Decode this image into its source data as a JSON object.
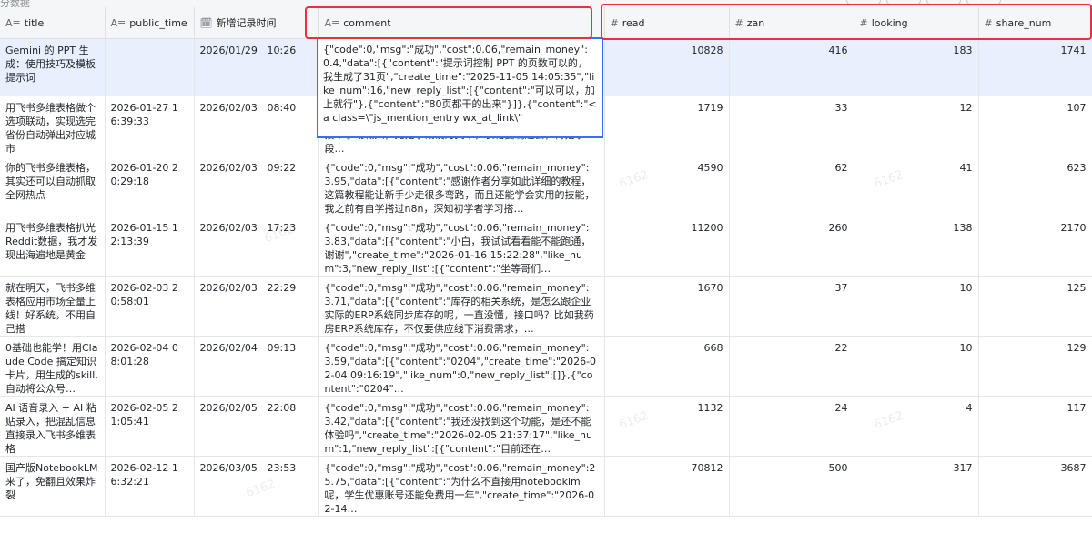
{
  "window": {
    "partial_label": "分数据"
  },
  "columns": [
    {
      "label": "title",
      "icon": "text-field-icon"
    },
    {
      "label": "public_time",
      "icon": "text-field-icon"
    },
    {
      "label": "新增记录时间",
      "icon": "created-time-icon"
    },
    {
      "label": "comment",
      "icon": "text-field-icon"
    },
    {
      "label": "read",
      "icon": "number-field-icon"
    },
    {
      "label": "zan",
      "icon": "number-field-icon"
    },
    {
      "label": "looking",
      "icon": "number-field-icon"
    },
    {
      "label": "share_num",
      "icon": "number-field-icon"
    }
  ],
  "rows": [
    {
      "title": "Gemini 的 PPT 生成：使用技巧及模板提示词",
      "public_time": "",
      "new_date": "2026/01/29",
      "new_time": "10:26",
      "comment": "",
      "read": "10828",
      "zan": "416",
      "looking": "183",
      "share_num": "1741"
    },
    {
      "title": "用飞书多维表格做个选项联动，实现选完省份自动弹出对应城市",
      "public_time": "2026-01-27 16:39:33",
      "new_date": "2026/02/03",
      "new_time": "08:40",
      "comment": "接个手动输入，先把字段设为文本，表格复制进去，再把字段…",
      "read": "1719",
      "zan": "33",
      "looking": "12",
      "share_num": "107"
    },
    {
      "title": "你的飞书多维表格，其实还可以自动抓取全网热点",
      "public_time": "2026-01-20 20:29:18",
      "new_date": "2026/02/03",
      "new_time": "09:22",
      "comment": "{\"code\":0,\"msg\":\"成功\",\"cost\":0.06,\"remain_money\":3.95,\"data\":[{\"content\":\"感谢作者分享如此详细的教程，这篇教程能让新手少走很多弯路，而且还能学会实用的技能，我之前有自学搭过n8n，深知初学者学习搭…",
      "read": "4590",
      "zan": "62",
      "looking": "41",
      "share_num": "623"
    },
    {
      "title": "用飞书多维表格扒光Reddit数据，我才发现出海遍地是黄金",
      "public_time": "2026-01-15 12:13:39",
      "new_date": "2026/02/03",
      "new_time": "17:23",
      "comment": "{\"code\":0,\"msg\":\"成功\",\"cost\":0.06,\"remain_money\":3.83,\"data\":[{\"content\":\"小白，我试试看看能不能跑通，谢谢\",\"create_time\":\"2026-01-16 15:22:28\",\"like_num\":3,\"new_reply_list\":[{\"content\":\"坐等哥们…",
      "read": "11200",
      "zan": "260",
      "looking": "138",
      "share_num": "2170"
    },
    {
      "title": "就在明天，飞书多维表格应用市场全量上线！好系统，不用自己搭",
      "public_time": "2026-02-03 20:58:01",
      "new_date": "2026/02/03",
      "new_time": "22:29",
      "comment": "{\"code\":0,\"msg\":\"成功\",\"cost\":0.06,\"remain_money\":3.71,\"data\":[{\"content\":\"库存的相关系统，是怎么跟企业实际的ERP系统同步库存的呢，一直没懂，接口吗？比如我药房ERP系统库存，不仅要供应线下消费需求，…",
      "read": "1670",
      "zan": "37",
      "looking": "10",
      "share_num": "125"
    },
    {
      "title": "0基础也能学！用Claude Code 搞定知识卡片，用生成的skill,自动将公众号…",
      "public_time": "2026-02-04 08:01:28",
      "new_date": "2026/02/04",
      "new_time": "09:13",
      "comment": "{\"code\":0,\"msg\":\"成功\",\"cost\":0.06,\"remain_money\":3.59,\"data\":[{\"content\":\"0204\",\"create_time\":\"2026-02-04 09:16:19\",\"like_num\":0,\"new_reply_list\":[]},{\"content\":\"0204\"…",
      "read": "668",
      "zan": "22",
      "looking": "10",
      "share_num": "129"
    },
    {
      "title": "AI 语音录入 + AI 粘贴录入，把混乱信息直接录入飞书多维表格",
      "public_time": "2026-02-05 21:05:41",
      "new_date": "2026/02/05",
      "new_time": "22:08",
      "comment": "{\"code\":0,\"msg\":\"成功\",\"cost\":0.06,\"remain_money\":3.42,\"data\":[{\"content\":\"我还没找到这个功能，是还不能体验吗\",\"create_time\":\"2026-02-05 21:37:17\",\"like_num\":1,\"new_reply_list\":[{\"content\":\"目前还在…",
      "read": "1132",
      "zan": "24",
      "looking": "4",
      "share_num": "117"
    },
    {
      "title": "国产版NotebookLM来了，免翻且效果炸裂",
      "public_time": "2026-02-12 16:32:21",
      "new_date": "2026/03/05",
      "new_time": "23:53",
      "comment": "{\"code\":0,\"msg\":\"成功\",\"cost\":0.06,\"remain_money\":25.75,\"data\":[{\"content\":\"为什么不直接用notebooklm呢，学生优惠账号还能免费用一年\",\"create_time\":\"2026-02-14…",
      "read": "70812",
      "zan": "500",
      "looking": "317",
      "share_num": "3687"
    }
  ],
  "expanded_comment": "{\"code\":0,\"msg\":\"成功\",\"cost\":0.06,\"remain_money\":0.4,\"data\":[{\"content\":\"提示词控制 PPT 的页数可以的，我生成了31页\",\"create_time\":\"2025-11-05 14:05:35\",\"like_num\":16,\"new_reply_list\":[{\"content\":\"可以可以，加上就行\"},{\"content\":\"80页都干的出来\"}]},{\"content\":\"<a class=\\\"js_mention_entry wx_at_link\\\"",
  "watermark": "6162",
  "colors": {
    "highlight": "#e8323a",
    "selection_border": "#3370ff",
    "selected_row": "#e8effd",
    "header_bg": "#f5f6f7"
  }
}
